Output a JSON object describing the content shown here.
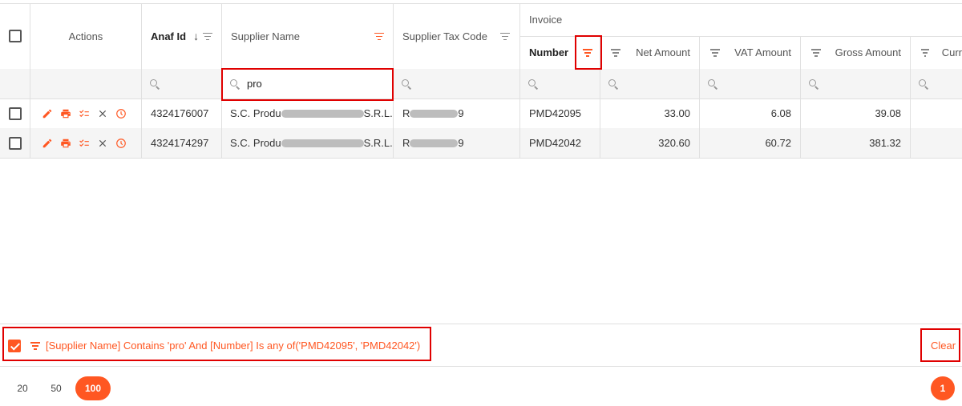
{
  "header": {
    "group_label": "Invoice",
    "columns": {
      "actions": "Actions",
      "anaf_id": "Anaf Id",
      "supplier_name": "Supplier Name",
      "supplier_tax_code": "Supplier Tax Code",
      "number": "Number",
      "net_amount": "Net Amount",
      "vat_amount": "VAT Amount",
      "gross_amount": "Gross Amount",
      "currency": "Curr"
    }
  },
  "filter_row": {
    "supplier_name_value": "pro"
  },
  "rows": [
    {
      "anaf_id": "4324176007",
      "supplier_prefix": "S.C. Produ",
      "supplier_suffix": "S.R.L.",
      "tax_prefix": "R",
      "tax_suffix": "9",
      "number": "PMD42095",
      "net_amount": "33.00",
      "vat_amount": "6.08",
      "gross_amount": "39.08"
    },
    {
      "anaf_id": "4324174297",
      "supplier_prefix": "S.C. Produ",
      "supplier_suffix": "S.R.L.",
      "tax_prefix": "R",
      "tax_suffix": "9",
      "number": "PMD42042",
      "net_amount": "320.60",
      "vat_amount": "60.72",
      "gross_amount": "381.32"
    }
  ],
  "filter_panel": {
    "expression": "[Supplier Name] Contains 'pro' And [Number] Is any of('PMD42095', 'PMD42042')",
    "clear_label": "Clear"
  },
  "pager": {
    "sizes": [
      "20",
      "50",
      "100"
    ],
    "selected_size": "100",
    "current_page": "1"
  },
  "colors": {
    "accent": "#ff5722",
    "highlight_box": "#e00000"
  }
}
